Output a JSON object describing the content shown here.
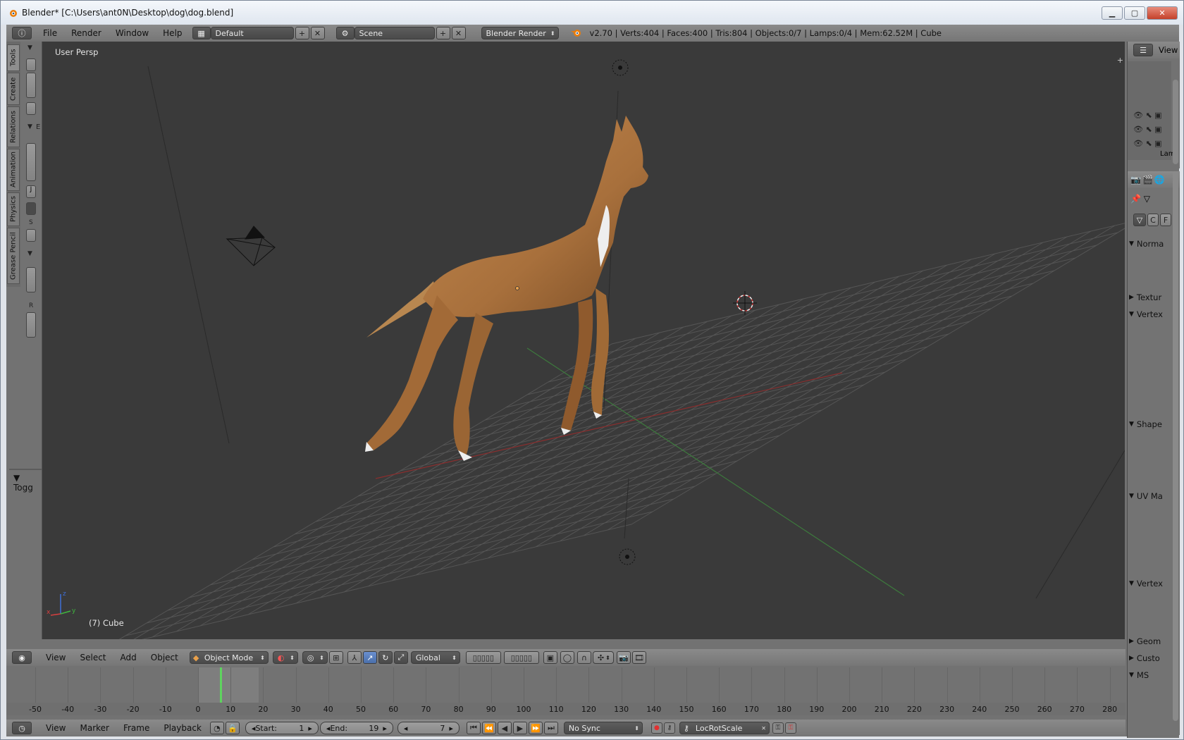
{
  "window": {
    "title": "Blender* [C:\\Users\\ant0N\\Desktop\\dog\\dog.blend]"
  },
  "info_header": {
    "menus": [
      "File",
      "Render",
      "Window",
      "Help"
    ],
    "layout": "Default",
    "scene": "Scene",
    "engine": "Blender Render",
    "stats": "v2.70 | Verts:404 | Faces:400 | Tris:804 | Objects:0/7 | Lamps:0/4 | Mem:62.52M | Cube"
  },
  "tool_tabs": [
    "Tools",
    "Create",
    "Relations",
    "Animation",
    "Physics",
    "Grease Pencil"
  ],
  "tool_shelf": {
    "labels": {
      "e": "E",
      "s": "S",
      "r": "R",
      "j": "J"
    },
    "toggle": "Togg"
  },
  "viewport": {
    "view_name": "User Persp",
    "object_label": "(7) Cube",
    "axes": {
      "x": "x",
      "y": "y",
      "z": "z"
    }
  },
  "view3d_header": {
    "menus": [
      "View",
      "Select",
      "Add",
      "Object"
    ],
    "mode": "Object Mode",
    "orientation": "Global"
  },
  "outliner": {
    "view_label": "View",
    "row_last": "Lam"
  },
  "properties": {
    "tabs_ctx": [
      "C",
      "F"
    ],
    "panels": [
      {
        "label": "Norma",
        "open": true
      },
      {
        "label": "Textur",
        "open": false
      },
      {
        "label": "Vertex",
        "open": true
      },
      {
        "label": "Shape",
        "open": true
      },
      {
        "label": "UV Ma",
        "open": true
      },
      {
        "label": "Vertex",
        "open": true
      },
      {
        "label": "Geom",
        "open": false
      },
      {
        "label": "Custo",
        "open": false
      },
      {
        "label": "MS",
        "open": true
      }
    ]
  },
  "timeline": {
    "ruler": [
      "-50",
      "-40",
      "-30",
      "-20",
      "-10",
      "0",
      "10",
      "20",
      "30",
      "40",
      "50",
      "60",
      "70",
      "80",
      "90",
      "100",
      "110",
      "120",
      "130",
      "140",
      "150",
      "160",
      "170",
      "180",
      "190",
      "200",
      "210",
      "220",
      "230",
      "240",
      "250",
      "260",
      "270",
      "280"
    ],
    "current_frame": 7,
    "menus": [
      "View",
      "Marker",
      "Frame",
      "Playback"
    ],
    "start_label": "Start:",
    "start": "1",
    "end_label": "End:",
    "end": "19",
    "frame": "7",
    "sync": "No Sync",
    "keying_set": "LocRotScale"
  },
  "colors": {
    "viewport_bg": "#3a3a3a",
    "grid": "#555555",
    "x_axis": "#8a2e2e",
    "y_axis": "#3d7a3d",
    "dog": "#b07a45",
    "frame_marker": "#5fd25f"
  }
}
